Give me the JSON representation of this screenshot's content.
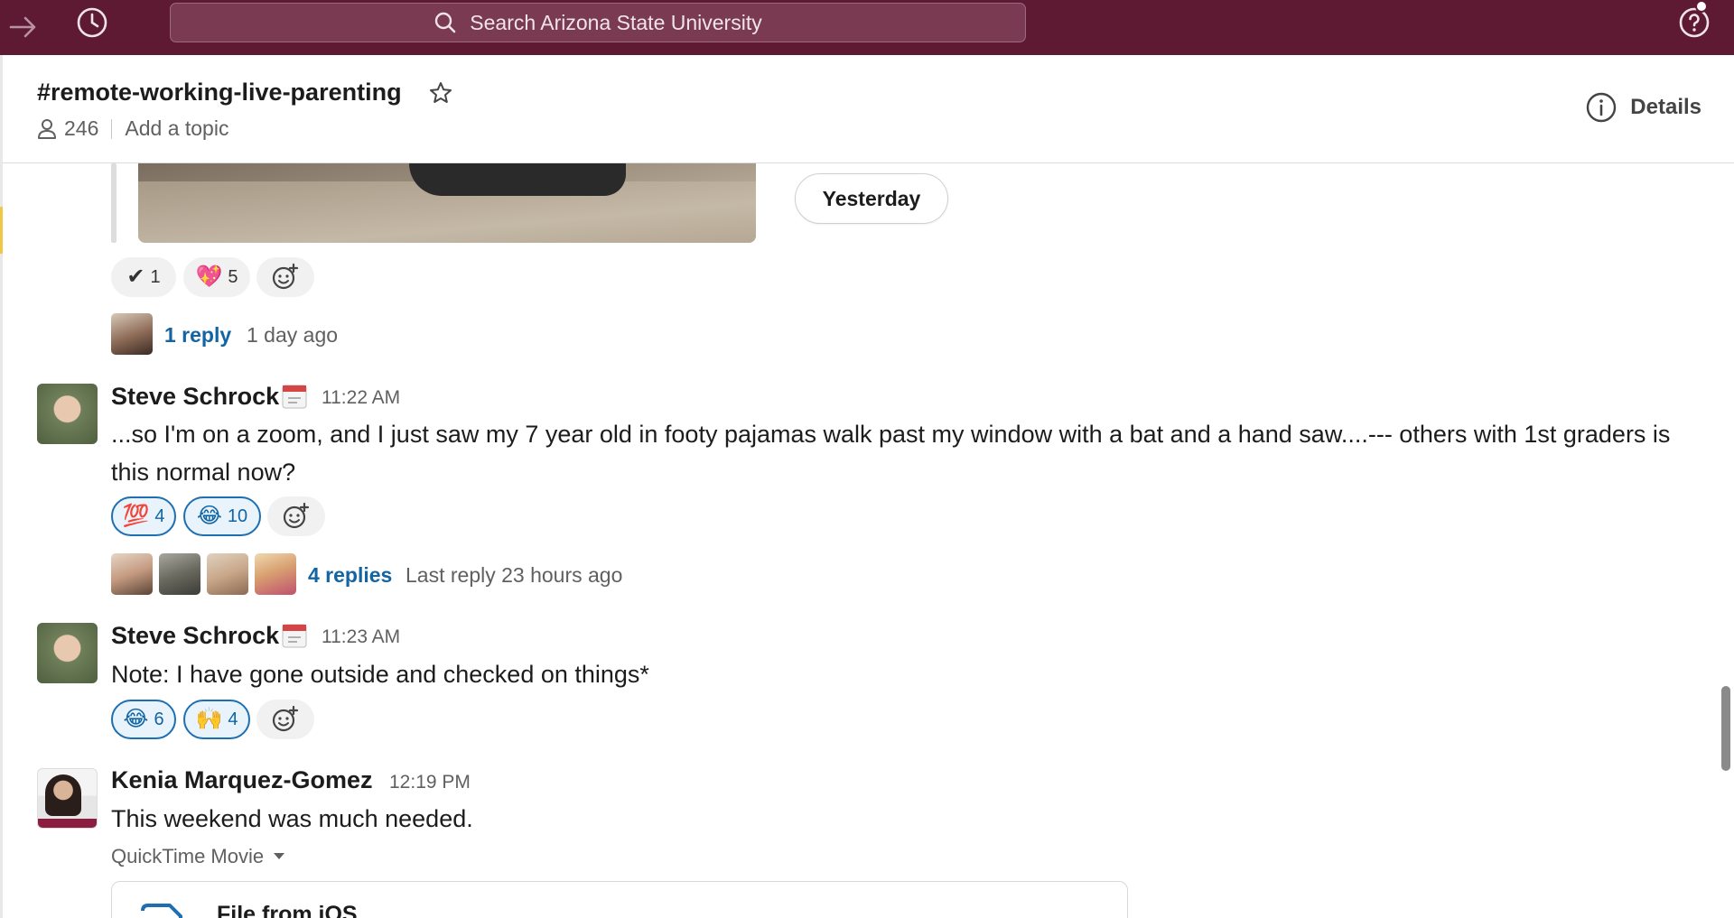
{
  "topbar": {
    "search_placeholder": "Search Arizona State University"
  },
  "channel": {
    "name": "#remote-working-live-parenting",
    "member_count": "246",
    "add_topic": "Add a topic",
    "details_label": "Details"
  },
  "thread0": {
    "jump_label": "Yesterday",
    "reactions": [
      {
        "emoji": "✔",
        "count": "1"
      },
      {
        "emoji": "💖",
        "count": "5"
      }
    ],
    "reply_count": "1 reply",
    "reply_time": "1 day ago"
  },
  "messages": [
    {
      "sender": "Steve Schrock",
      "time": "11:22 AM",
      "text": "...so I'm on a zoom, and I just saw my 7 year old in footy pajamas walk past my window with a bat and a hand saw....--- others with 1st graders is this normal now?",
      "reactions": [
        {
          "emoji": "💯",
          "count": "4"
        },
        {
          "emoji": "😂",
          "count": "10"
        }
      ],
      "reply_count": "4 replies",
      "reply_time": "Last reply 23 hours ago"
    },
    {
      "sender": "Steve Schrock",
      "time": "11:23 AM",
      "text": "Note: I have gone outside and checked on things*",
      "reactions": [
        {
          "emoji": "😂",
          "count": "6"
        },
        {
          "emoji": "🙌",
          "count": "4"
        }
      ]
    },
    {
      "sender": "Kenia Marquez-Gomez",
      "time": "12:19 PM",
      "text": "This weekend was much needed.",
      "file_type": "QuickTime Movie",
      "file_title": "File from iOS"
    }
  ],
  "colors": {
    "topbar": "#5e1a33",
    "link": "#1264a3",
    "reaction_mine_border": "#1d6fb1"
  },
  "icons": [
    "forward-arrow-icon",
    "history-icon",
    "search-icon",
    "help-icon",
    "star-icon",
    "person-icon",
    "info-icon",
    "calendar-icon",
    "add-reaction-icon",
    "caret-down-icon",
    "file-icon"
  ]
}
